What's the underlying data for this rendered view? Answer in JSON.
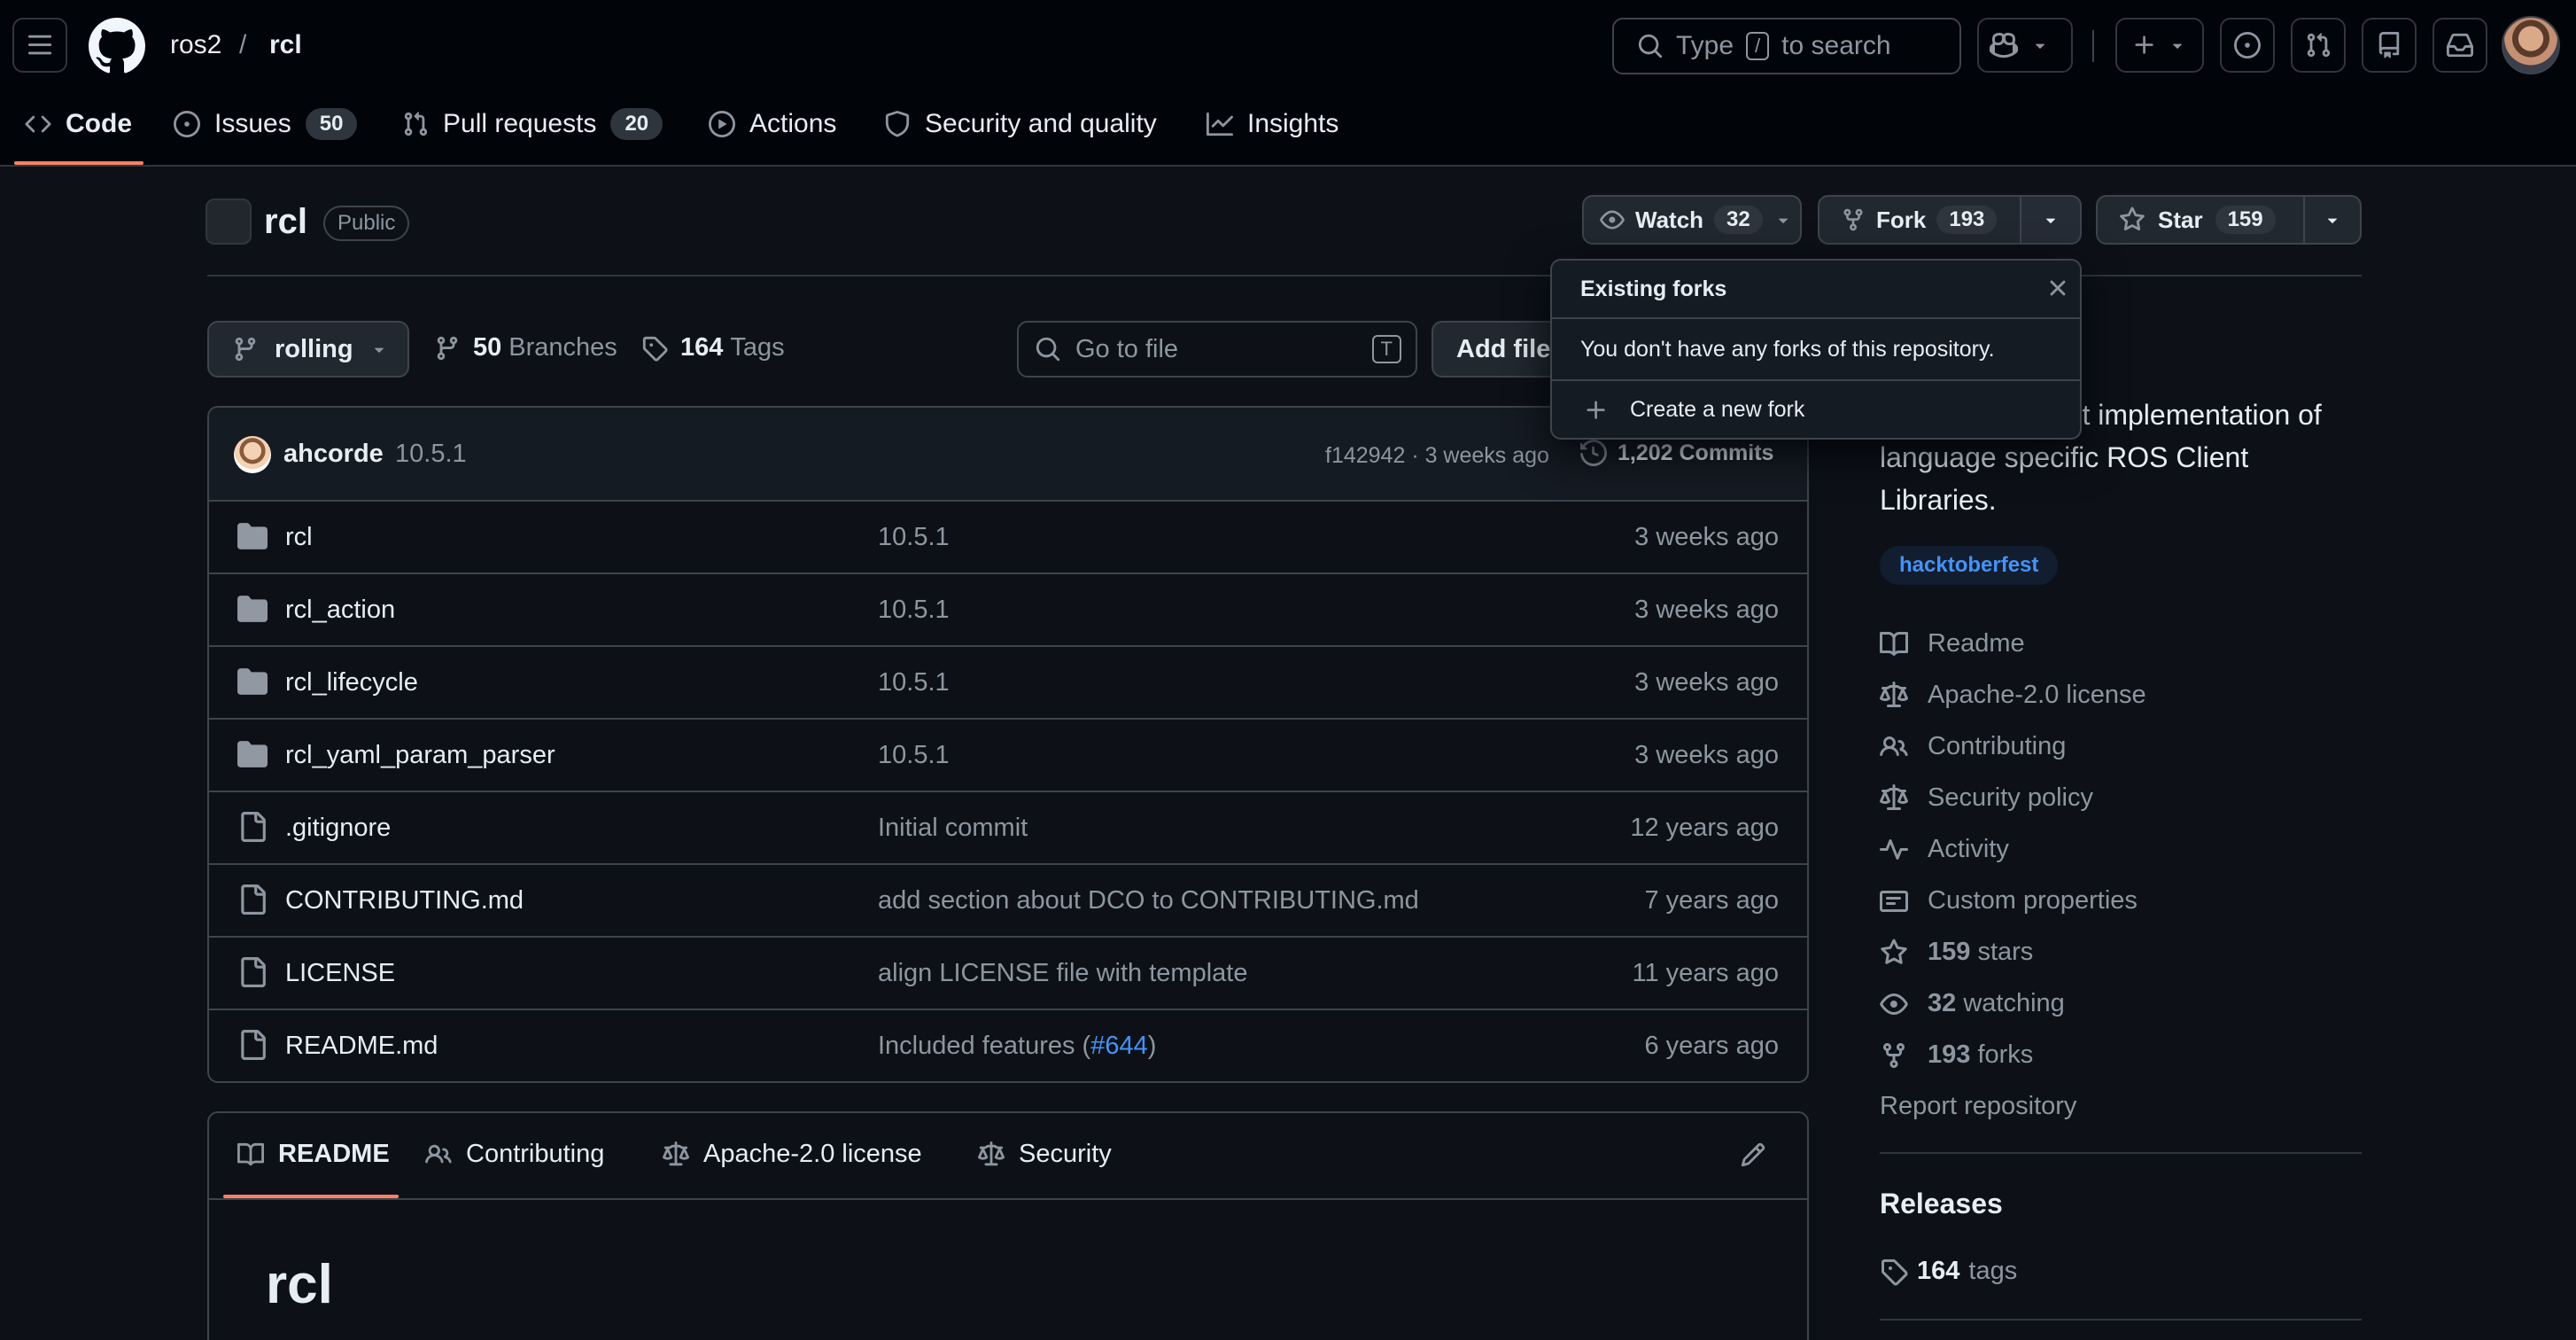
{
  "header": {
    "owner": "ros2",
    "separator": "/",
    "repo": "rcl",
    "search_prefix": "Type",
    "search_key": "/",
    "search_suffix": "to search"
  },
  "tabs": [
    {
      "label": "Code"
    },
    {
      "label": "Issues",
      "count": "50"
    },
    {
      "label": "Pull requests",
      "count": "20"
    },
    {
      "label": "Actions"
    },
    {
      "label": "Security and quality"
    },
    {
      "label": "Insights"
    }
  ],
  "repo": {
    "name": "rcl",
    "visibility": "Public",
    "watch_label": "Watch",
    "watch_count": "32",
    "fork_label": "Fork",
    "fork_count": "193",
    "star_label": "Star",
    "star_count": "159"
  },
  "fork_popover": {
    "title": "Existing forks",
    "message": "You don't have any forks of this repository.",
    "action": "Create a new fork"
  },
  "toolbar": {
    "branch": "rolling",
    "branches_count": "50",
    "branches_label": "Branches",
    "tags_count": "164",
    "tags_label": "Tags",
    "goto_placeholder": "Go to file",
    "goto_key": "T",
    "add_file": "Add file"
  },
  "commit": {
    "author": "ahcorde",
    "message": "10.5.1",
    "hash_time": "f142942 · 3 weeks ago",
    "commits": "1,202 Commits"
  },
  "files": [
    {
      "type": "dir",
      "name": "rcl",
      "message": "10.5.1",
      "age": "3 weeks ago"
    },
    {
      "type": "dir",
      "name": "rcl_action",
      "message": "10.5.1",
      "age": "3 weeks ago"
    },
    {
      "type": "dir",
      "name": "rcl_lifecycle",
      "message": "10.5.1",
      "age": "3 weeks ago"
    },
    {
      "type": "dir",
      "name": "rcl_yaml_param_parser",
      "message": "10.5.1",
      "age": "3 weeks ago"
    },
    {
      "type": "file",
      "name": ".gitignore",
      "message": "Initial commit",
      "age": "12 years ago"
    },
    {
      "type": "file",
      "name": "CONTRIBUTING.md",
      "message": "add section about DCO to CONTRIBUTING.md",
      "age": "7 years ago"
    },
    {
      "type": "file",
      "name": "LICENSE",
      "message": "align LICENSE file with template",
      "age": "11 years ago"
    },
    {
      "type": "file",
      "name": "README.md",
      "message": "Included features (",
      "link": "#644",
      "message_end": ")",
      "age": "6 years ago"
    }
  ],
  "readme": {
    "tabs": [
      "README",
      "Contributing",
      "Apache-2.0 license",
      "Security"
    ],
    "heading": "rcl"
  },
  "about": {
    "description_lines": [
      "ort implementation of",
      "language specific ROS Client",
      "Libraries."
    ],
    "topic": "hacktoberfest",
    "links": [
      {
        "label": "Readme"
      },
      {
        "label": "Apache-2.0 license"
      },
      {
        "label": "Contributing"
      },
      {
        "label": "Security policy"
      },
      {
        "label": "Activity"
      },
      {
        "label": "Custom properties"
      },
      {
        "count": "159",
        "label": "stars"
      },
      {
        "count": "32",
        "label": "watching"
      },
      {
        "count": "193",
        "label": "forks"
      }
    ],
    "report": "Report repository"
  },
  "releases": {
    "title": "Releases",
    "count": "164",
    "label": "tags"
  },
  "colors": {
    "accent": "#f78166",
    "link": "#4493f8",
    "background": "#0d1117"
  }
}
